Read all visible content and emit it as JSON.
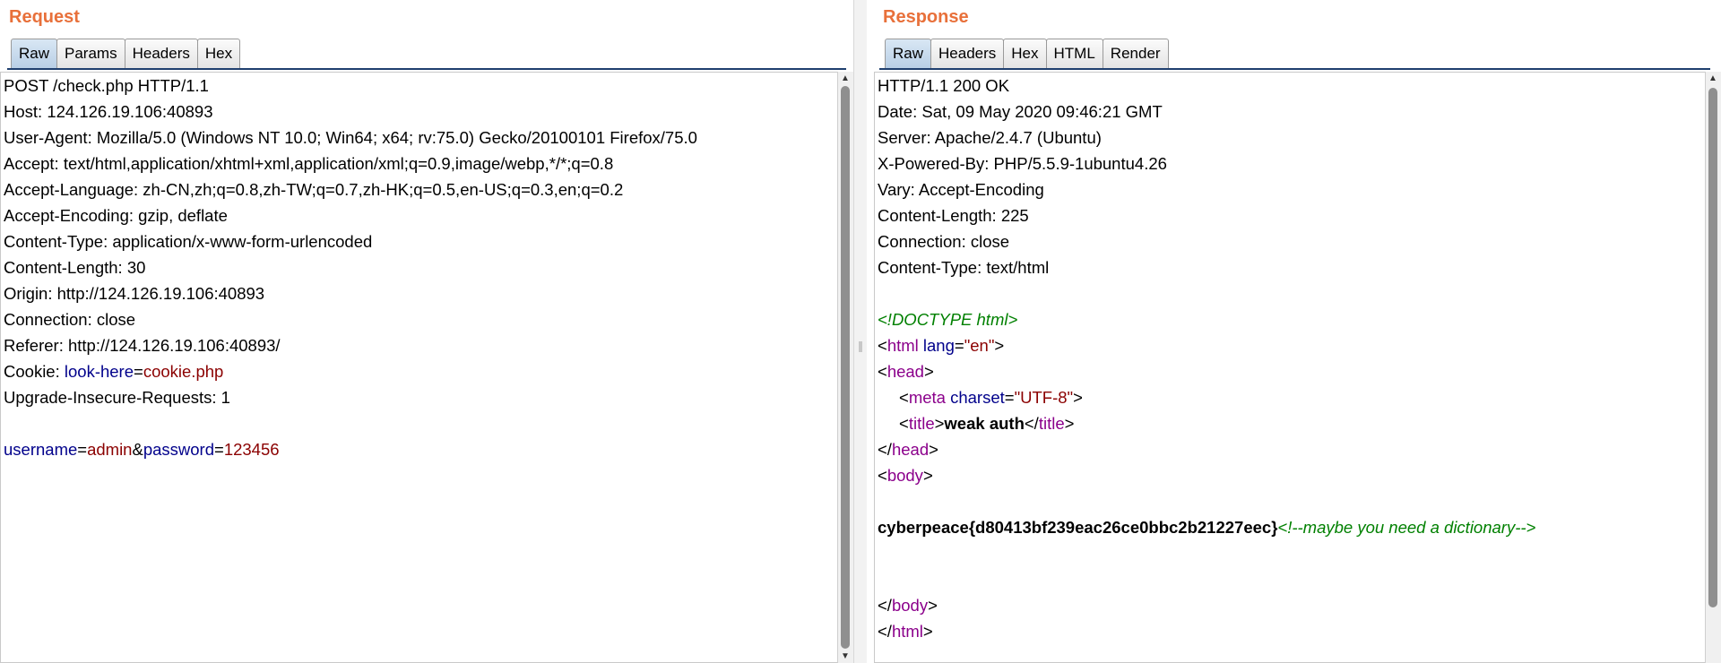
{
  "request": {
    "title": "Request",
    "tabs": [
      "Raw",
      "Params",
      "Headers",
      "Hex"
    ],
    "lines": {
      "l0": "POST /check.php HTTP/1.1",
      "l1": "Host: 124.126.19.106:40893",
      "l2": "User-Agent: Mozilla/5.0 (Windows NT 10.0; Win64; x64; rv:75.0) Gecko/20100101 Firefox/75.0",
      "l3": "Accept: text/html,application/xhtml+xml,application/xml;q=0.9,image/webp,*/*;q=0.8",
      "l4": "Accept-Language: zh-CN,zh;q=0.8,zh-TW;q=0.7,zh-HK;q=0.5,en-US;q=0.3,en;q=0.2",
      "l5": "Accept-Encoding: gzip, deflate",
      "l6": "Content-Type: application/x-www-form-urlencoded",
      "l7": "Content-Length: 30",
      "l8": "Origin: http://124.126.19.106:40893",
      "l9": "Connection: close",
      "l10": "Referer: http://124.126.19.106:40893/",
      "l12": "Upgrade-Insecure-Requests: 1"
    },
    "cookie": {
      "prefix": "Cookie: ",
      "name": "look-here",
      "eq": "=",
      "value": "cookie.php"
    },
    "body": {
      "k1": "username",
      "eq": "=",
      "v1": "admin",
      "amp": "&",
      "k2": "password",
      "v2": "123456"
    }
  },
  "response": {
    "title": "Response",
    "tabs": [
      "Raw",
      "Headers",
      "Hex",
      "HTML",
      "Render"
    ],
    "headers": {
      "l0": "HTTP/1.1 200 OK",
      "l1": "Date: Sat, 09 May 2020 09:46:21 GMT",
      "l2": "Server: Apache/2.4.7 (Ubuntu)",
      "l3": "X-Powered-By: PHP/5.5.9-1ubuntu4.26",
      "l4": "Vary: Accept-Encoding",
      "l5": "Content-Length: 225",
      "l6": "Connection: close",
      "l7": "Content-Type: text/html"
    },
    "html": {
      "doctype": "<!DOCTYPE html>",
      "lt": "<",
      "gt": ">",
      "lt_slash": "</",
      "eq": "=",
      "html_tag": "html",
      "lang_attr": "lang",
      "lang_val": "\"en\"",
      "head_tag": "head",
      "meta_tag": "meta",
      "charset_attr": "charset",
      "charset_val": "\"UTF-8\"",
      "title_tag": "title",
      "title_text": "weak auth",
      "body_tag": "body",
      "flag": "cyberpeace{d80413bf239eac26ce0bbc2b21227eec}",
      "comment": "<!--maybe you need a dictionary-->"
    }
  }
}
